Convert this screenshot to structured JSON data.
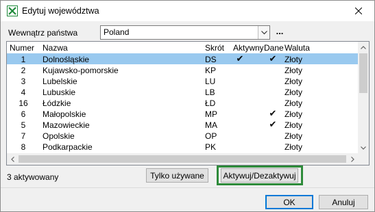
{
  "window": {
    "title": "Edytuj województwa"
  },
  "filter": {
    "label": "Wewnątrz państwa",
    "value": "Poland",
    "more_label": "..."
  },
  "table": {
    "columns": [
      "Numer",
      "Nazwa",
      "Skrót",
      "Aktywny",
      "Dane",
      "Waluta"
    ],
    "rows": [
      {
        "num": "1",
        "name": "Dolnośląskie",
        "abbr": "DS",
        "active": "✔",
        "data": "✔",
        "currency": "Złoty",
        "selected": true
      },
      {
        "num": "2",
        "name": "Kujawsko-pomorskie",
        "abbr": "KP",
        "active": "",
        "data": "",
        "currency": "Złoty",
        "selected": false
      },
      {
        "num": "3",
        "name": "Lubelskie",
        "abbr": "LU",
        "active": "",
        "data": "",
        "currency": "Złoty",
        "selected": false
      },
      {
        "num": "4",
        "name": "Lubuskie",
        "abbr": "LB",
        "active": "",
        "data": "",
        "currency": "Złoty",
        "selected": false
      },
      {
        "num": "16",
        "name": "Łódzkie",
        "abbr": "ŁD",
        "active": "",
        "data": "",
        "currency": "Złoty",
        "selected": false
      },
      {
        "num": "6",
        "name": "Małopolskie",
        "abbr": "MP",
        "active": "",
        "data": "✔",
        "currency": "Złoty",
        "selected": false
      },
      {
        "num": "5",
        "name": "Mazowieckie",
        "abbr": "MA",
        "active": "",
        "data": "✔",
        "currency": "Złoty",
        "selected": false
      },
      {
        "num": "7",
        "name": "Opolskie",
        "abbr": "OP",
        "active": "",
        "data": "",
        "currency": "Złoty",
        "selected": false
      },
      {
        "num": "8",
        "name": "Podkarpackie",
        "abbr": "PK",
        "active": "",
        "data": "",
        "currency": "Złoty",
        "selected": false
      }
    ]
  },
  "status": {
    "text": "3 aktywowany"
  },
  "buttons": {
    "only_used": "Tylko używane",
    "toggle": "Aktywuj/Dezaktywuj",
    "ok": "OK",
    "cancel": "Anuluj"
  },
  "colors": {
    "selection": "#99c9ef",
    "highlight_frame": "#2e8b3a",
    "app_icon": "#1f8a3b"
  },
  "icons": {
    "app": "excel-x-icon",
    "close": "close-icon",
    "dropdown": "chevron-down-icon"
  }
}
